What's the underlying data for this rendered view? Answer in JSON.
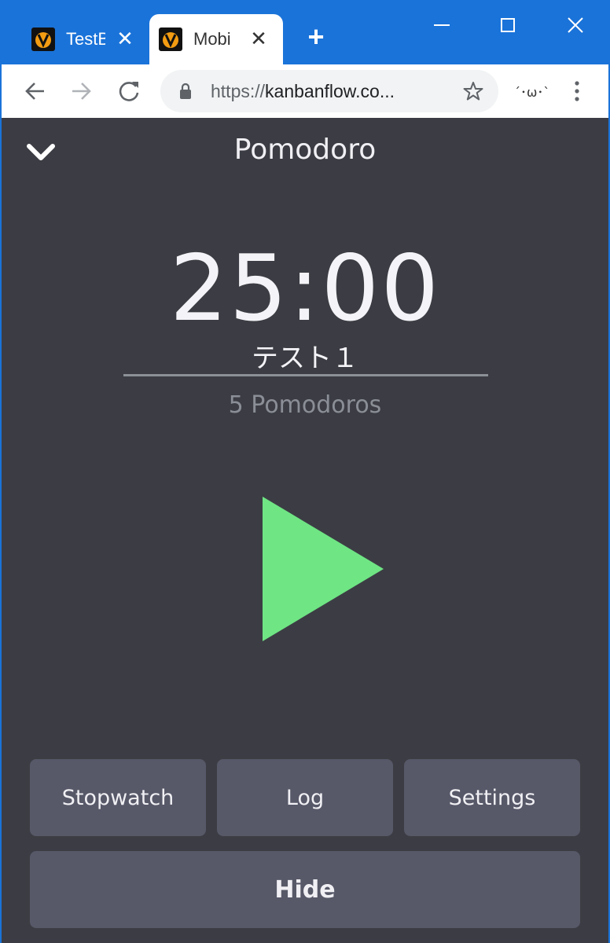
{
  "browser": {
    "tabs": [
      {
        "title": "TestB"
      },
      {
        "title": "Mobi"
      }
    ],
    "url": {
      "scheme": "https://",
      "host": "kanbanflow.co..."
    },
    "extension_label": "´･ω･`"
  },
  "app": {
    "title": "Pomodoro",
    "timer": "25:00",
    "task_name": "テスト１",
    "pomodoro_count": "5 Pomodoros",
    "buttons": {
      "stopwatch": "Stopwatch",
      "log": "Log",
      "settings": "Settings",
      "hide": "Hide"
    }
  },
  "colors": {
    "titlebar": "#1a73d9",
    "app_background": "#3c3d44",
    "button_background": "#575868",
    "play_accent": "#6fe584"
  },
  "icons": [
    "favicon-icon",
    "close-icon",
    "new-tab-icon",
    "minimize-icon",
    "maximize-icon",
    "window-close-icon",
    "back-icon",
    "forward-icon",
    "reload-icon",
    "lock-icon",
    "star-icon",
    "menu-icon",
    "chevron-down-icon",
    "play-icon"
  ]
}
